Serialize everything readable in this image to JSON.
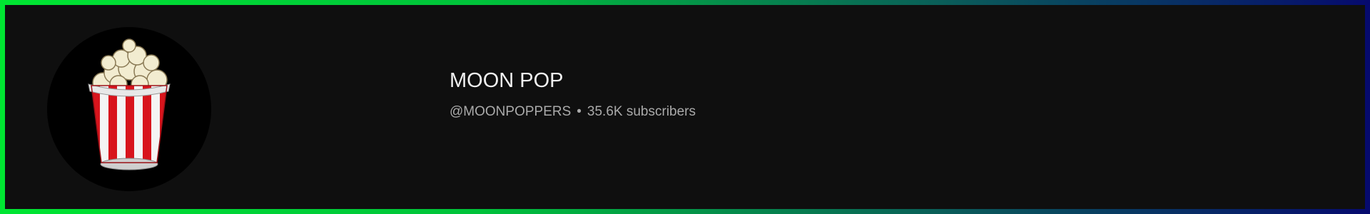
{
  "channel": {
    "name": "MOON POP",
    "handle": "@MOONPOPPERS",
    "separator": "•",
    "subscribers": "35.6K subscribers",
    "avatar_icon": "popcorn-bucket-icon"
  },
  "colors": {
    "background": "#0f0f0f",
    "border_start": "#00e632",
    "border_end": "#060a6e",
    "name_text": "#f1f1f1",
    "meta_text": "#aaaaaa",
    "bucket_red": "#d8141c",
    "bucket_white": "#f4f4f4",
    "popcorn": "#f2ecd0"
  }
}
